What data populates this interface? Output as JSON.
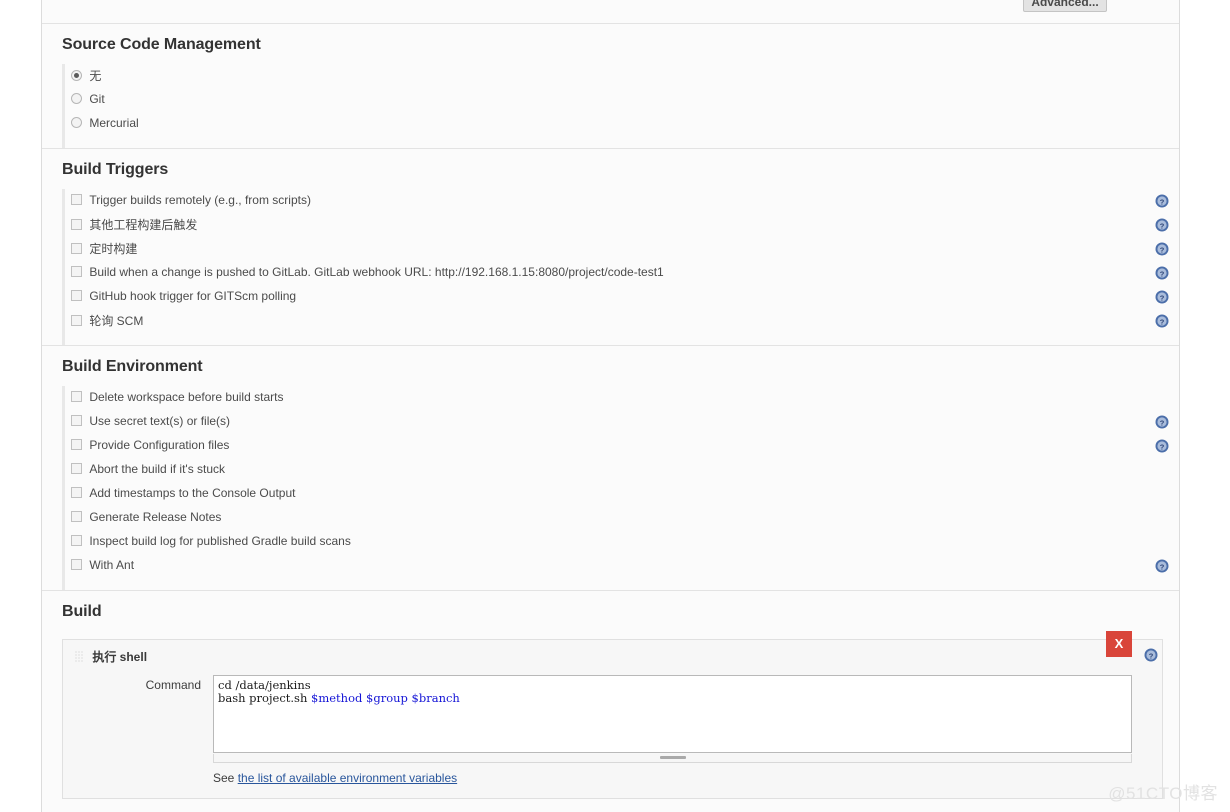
{
  "toolbar": {
    "advanced_label": "Advanced..."
  },
  "sections": {
    "scm": {
      "title": "Source Code Management",
      "options": [
        {
          "label": "无",
          "checked": true
        },
        {
          "label": "Git",
          "checked": false
        },
        {
          "label": "Mercurial",
          "checked": false
        }
      ]
    },
    "build_triggers": {
      "title": "Build Triggers",
      "options": [
        {
          "label": "Trigger builds remotely (e.g., from scripts)",
          "help": true
        },
        {
          "label": "其他工程构建后触发",
          "help": true
        },
        {
          "label": "定时构建",
          "help": true
        },
        {
          "label": "Build when a change is pushed to GitLab. GitLab webhook URL: http://192.168.1.15:8080/project/code-test1",
          "help": true
        },
        {
          "label": "GitHub hook trigger for GITScm polling",
          "help": true
        },
        {
          "label": "轮询 SCM",
          "help": true
        }
      ]
    },
    "build_environment": {
      "title": "Build Environment",
      "options": [
        {
          "label": "Delete workspace before build starts",
          "help": false
        },
        {
          "label": "Use secret text(s) or file(s)",
          "help": true
        },
        {
          "label": "Provide Configuration files",
          "help": true
        },
        {
          "label": "Abort the build if it's stuck",
          "help": false
        },
        {
          "label": "Add timestamps to the Console Output",
          "help": false
        },
        {
          "label": "Generate Release Notes",
          "help": false
        },
        {
          "label": "Inspect build log for published Gradle build scans",
          "help": false
        },
        {
          "label": "With Ant",
          "help": true
        }
      ]
    },
    "build": {
      "title": "Build",
      "builder_title": "执行 shell",
      "close_label": "X",
      "command_label": "Command",
      "command_line1": "cd /data/jenkins",
      "command_line2_prefix": "bash project.sh ",
      "command_vars": "$method $group $branch",
      "see_text": "See ",
      "env_link_text": "the list of available environment variables"
    }
  },
  "watermark": "@51CTO博客",
  "colors": {
    "help_icon": "#4b6ea9",
    "close_button": "#d9453a",
    "link": "#29569c",
    "command_variable": "#1414d6",
    "panel_bg": "#fbfbfb"
  }
}
